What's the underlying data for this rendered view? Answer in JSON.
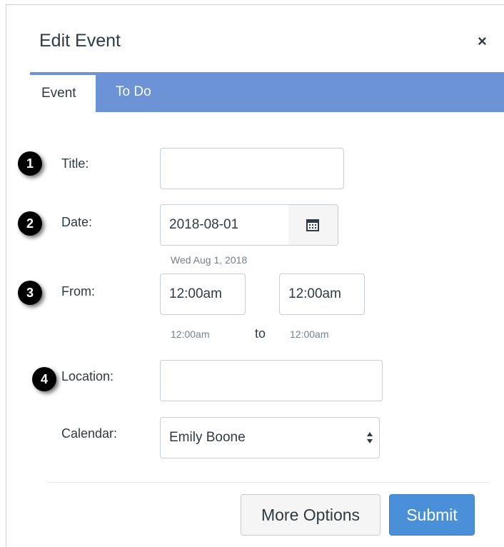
{
  "dialog": {
    "title": "Edit Event",
    "close_glyph": "×",
    "tabs": [
      {
        "label": "Event",
        "active": true
      },
      {
        "label": "To Do",
        "active": false
      }
    ]
  },
  "form": {
    "badges": [
      "1",
      "2",
      "3",
      "4"
    ],
    "title_label": "Title:",
    "title_value": "",
    "date_label": "Date:",
    "date_value": "2018-08-01",
    "date_helper": "Wed Aug 1, 2018",
    "from_label": "From:",
    "from_value": "12:00am",
    "to_value": "12:00am",
    "from_helper": "12:00am",
    "to_word": "to",
    "to_helper": "12:00am",
    "location_label": "Location:",
    "location_value": "",
    "calendar_label": "Calendar:",
    "calendar_value": "Emily Boone"
  },
  "footer": {
    "more_options_label": "More Options",
    "submit_label": "Submit"
  },
  "colors": {
    "tab_bar": "#6b93d6",
    "submit": "#4a90d9",
    "text": "#2d3b45",
    "helper": "#73818c"
  },
  "icons": [
    "close-icon",
    "calendar-icon",
    "select-arrows-icon"
  ]
}
